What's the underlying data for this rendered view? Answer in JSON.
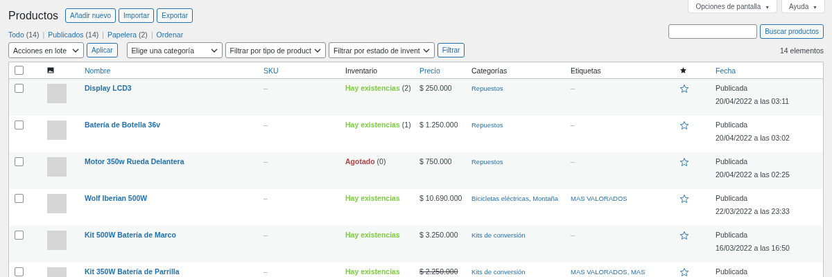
{
  "page_title": "Productos",
  "header_buttons": [
    "Añadir nuevo",
    "Importar",
    "Exportar"
  ],
  "screen_tabs": [
    {
      "label": "Opciones de pantalla",
      "caret": "▼"
    },
    {
      "label": "Ayuda",
      "caret": "▼"
    }
  ],
  "views": [
    {
      "label": "Todo",
      "count": "(14)"
    },
    {
      "separator": "|",
      "label": "Publicados",
      "count": "(14)"
    },
    {
      "separator": "|",
      "label": "Papelera",
      "count": "(2)"
    },
    {
      "separator": "|",
      "label": "Ordenar"
    }
  ],
  "search": {
    "button": "Buscar productos"
  },
  "filters": {
    "bulk_select": "Acciones en lote",
    "apply_button": "Aplicar",
    "selects": [
      "Elige una categoría",
      "Filtrar por tipo de product",
      "Filtrar por estado de invent"
    ],
    "filter_button": "Filtrar"
  },
  "item_count": "14 elementos",
  "table": {
    "select_all_checked": false,
    "columns": {
      "name": "Nombre",
      "sku": "SKU",
      "stock": "Inventario",
      "price": "Precio",
      "categories": "Categorías",
      "tags": "Etiquetas",
      "date": "Fecha"
    },
    "rows": [
      {
        "checked": false,
        "name": "Display LCD3",
        "sku": "–",
        "kind": "instock",
        "stock": "Hay existencias",
        "stock_count": "(2)",
        "price": "$ 250.000",
        "price_struck": false,
        "categories": "Repuestos",
        "tags": "–",
        "tags_linked": false,
        "featured": false,
        "status": "Publicada",
        "date": "20/04/2022 a las 03:11"
      },
      {
        "checked": false,
        "name": "Batería de Botella 36v",
        "sku": "–",
        "kind": "instock",
        "stock": "Hay existencias",
        "stock_count": "(1)",
        "price": "$ 1.250.000",
        "price_struck": false,
        "categories": "Repuestos",
        "tags": "–",
        "tags_linked": false,
        "featured": false,
        "status": "Publicada",
        "date": "20/04/2022 a las 03:02"
      },
      {
        "checked": false,
        "name": "Motor 350w Rueda Delantera",
        "sku": "–",
        "kind": "outofstock",
        "stock": "Agotado",
        "stock_count": "(0)",
        "price": "$ 750.000",
        "price_struck": false,
        "categories": "Repuestos",
        "tags": "–",
        "tags_linked": false,
        "featured": false,
        "status": "Publicada",
        "date": "20/04/2022 a las 02:25"
      },
      {
        "checked": false,
        "name": "Wolf Iberian 500W",
        "sku": "–",
        "kind": "instock",
        "stock": "Hay existencias",
        "price": "$ 10.690.000",
        "price_struck": false,
        "categories": "Bicicletas eléctricas, Montaña",
        "tags": "MAS VALORADOS",
        "tags_linked": true,
        "featured": false,
        "status": "Publicada",
        "date": "22/03/2022 a las 23:33"
      },
      {
        "checked": false,
        "name": "Kit 500W Batería de Marco",
        "sku": "–",
        "kind": "instock",
        "stock": "Hay existencias",
        "price": "$ 3.250.000",
        "price_struck": false,
        "categories": "Kits de conversión",
        "tags": "–",
        "tags_linked": false,
        "featured": false,
        "status": "Publicada",
        "date": "16/03/2022 a las 16:50"
      },
      {
        "checked": false,
        "name": "Kit 350W Batería de Parrilla",
        "sku": "–",
        "kind": "instock",
        "stock": "Hay existencias",
        "price": "$ 2.250.000",
        "price_struck": true,
        "categories": "Kits de conversión",
        "tags": "MAS VALORADOS, MAS",
        "tags_linked": true,
        "featured": false,
        "status": "Publicada"
      }
    ]
  }
}
